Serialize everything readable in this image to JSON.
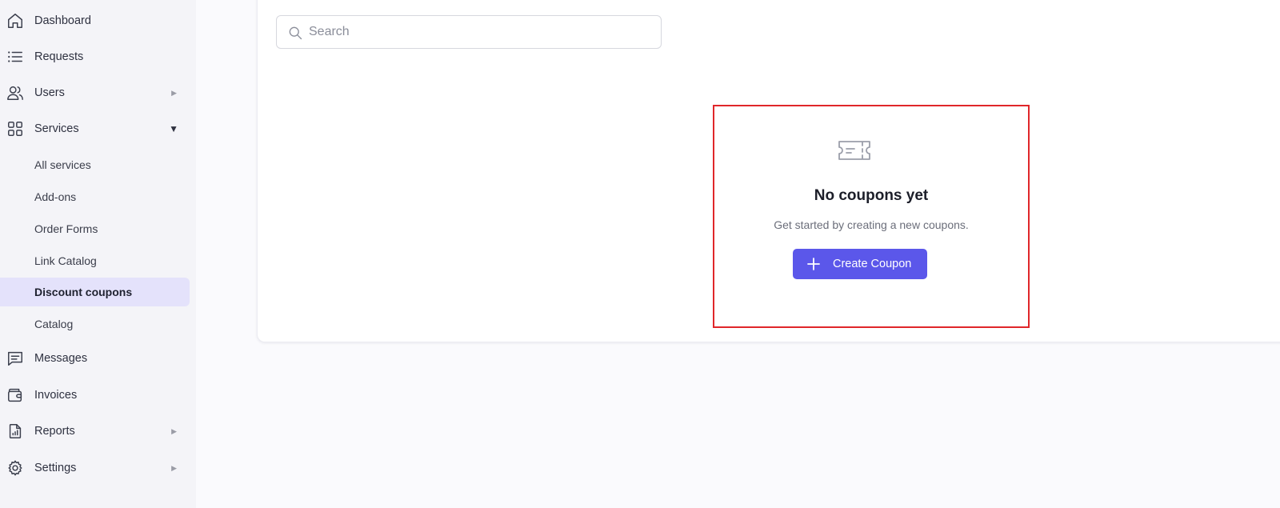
{
  "sidebar": {
    "items": [
      {
        "label": "Dashboard",
        "icon": "home-icon"
      },
      {
        "label": "Requests",
        "icon": "list-icon"
      },
      {
        "label": "Users",
        "icon": "users-icon",
        "caret": "▶"
      },
      {
        "label": "Services",
        "icon": "grid-icon",
        "caret": "▼"
      },
      {
        "label": "Messages",
        "icon": "message-icon"
      },
      {
        "label": "Invoices",
        "icon": "wallet-icon"
      },
      {
        "label": "Reports",
        "icon": "report-icon",
        "caret": "▶"
      },
      {
        "label": "Settings",
        "icon": "gear-icon",
        "caret": "▶"
      }
    ],
    "services_sub": [
      {
        "label": "All services"
      },
      {
        "label": "Add-ons"
      },
      {
        "label": "Order Forms"
      },
      {
        "label": "Link Catalog"
      },
      {
        "label": "Discount coupons",
        "active": true
      },
      {
        "label": "Catalog"
      }
    ]
  },
  "search": {
    "placeholder": "Search",
    "value": ""
  },
  "empty_state": {
    "icon": "coupon-ticket-icon",
    "title": "No coupons yet",
    "description": "Get started by creating a new coupons.",
    "button_label": "Create Coupon"
  },
  "colors": {
    "accent": "#5b57ea",
    "active_bg": "#e4e2fb",
    "highlight_border": "#e0262a"
  }
}
